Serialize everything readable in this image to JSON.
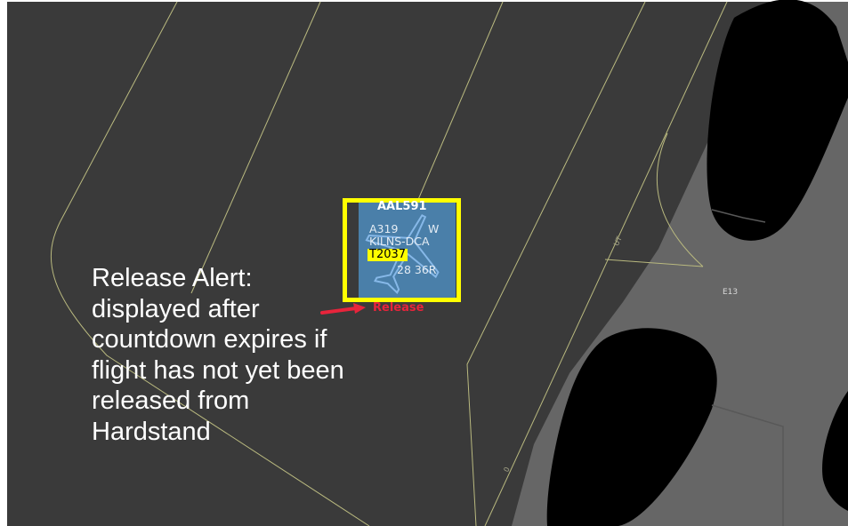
{
  "flight_strip": {
    "callsign": "AAL591",
    "aircraft_type": "A319",
    "wake_category": "W",
    "route": "KILNS-DCA",
    "countdown": "T2037",
    "gate_info": "28 36R",
    "alert_label": "Release"
  },
  "annotation": {
    "text": "Release Alert:\ndisplayed after\ncountdown expires if\nflight has not yet been\nreleased from\nHardstand"
  },
  "map_labels": {
    "taxiway": "E13",
    "edge_label_1": "UT",
    "edge_label_2": "0"
  },
  "colors": {
    "background": "#3a3a3a",
    "pavement": "#666666",
    "hole": "#000000",
    "centerline": "#b9b97f",
    "highlight": "#ffff00",
    "strip": "#4a7fa9",
    "alert": "#e8243b"
  }
}
